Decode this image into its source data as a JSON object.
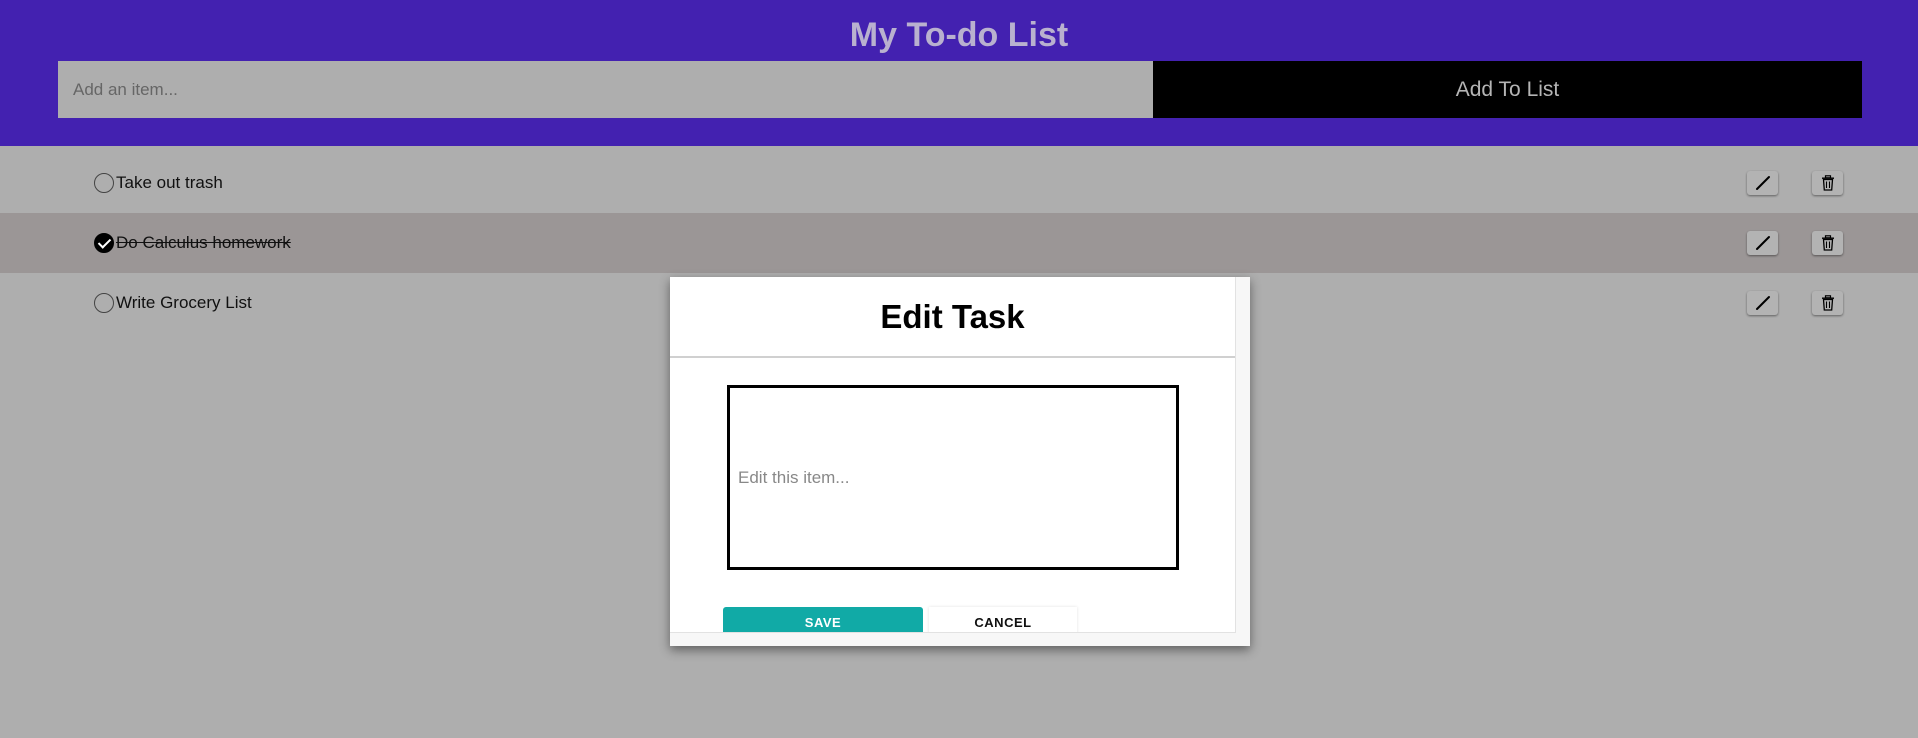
{
  "header": {
    "title": "My To-do List",
    "input_placeholder": "Add an item...",
    "input_value": "",
    "add_button_label": "Add To List",
    "background_color": "#4321b0"
  },
  "todos": [
    {
      "label": "Take out trash",
      "completed": false
    },
    {
      "label": "Do Calculus homework",
      "completed": true
    },
    {
      "label": "Write Grocery List",
      "completed": false
    }
  ],
  "row_icons": {
    "edit": "pencil-icon",
    "delete": "trash-icon"
  },
  "modal": {
    "title": "Edit Task",
    "field_placeholder": "Edit this item...",
    "field_value": "",
    "save_label": "SAVE",
    "cancel_label": "CANCEL",
    "save_color": "#11aaa6"
  }
}
